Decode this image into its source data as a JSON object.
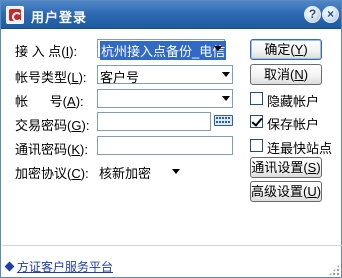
{
  "window": {
    "title": "用户登录",
    "help_glyph": "?",
    "close_glyph": "×"
  },
  "form": {
    "access_point": {
      "label": "接 入 点",
      "hotkey": "I",
      "value": "杭州接入点备份_电信"
    },
    "account_type": {
      "label": "帐号类型",
      "hotkey": "L",
      "value": "客户号"
    },
    "account": {
      "label": "帐      号",
      "hotkey": "A",
      "value": ""
    },
    "trade_password": {
      "label": "交易密码",
      "hotkey": "G",
      "value": ""
    },
    "comm_password": {
      "label": "通讯密码",
      "hotkey": "K",
      "value": ""
    },
    "encryption": {
      "label": "加密协议",
      "hotkey": "C",
      "value": "核新加密"
    }
  },
  "buttons": {
    "confirm": {
      "text": "确定",
      "hotkey": "Y"
    },
    "cancel": {
      "text": "取消",
      "hotkey": "N"
    },
    "comm_settings": {
      "text": "通讯设置",
      "hotkey": "S"
    },
    "advanced_settings": {
      "text": "高级设置",
      "hotkey": "U"
    }
  },
  "options": {
    "hide_account": {
      "label": "隐藏帐户",
      "checked": false
    },
    "save_account": {
      "label": "保存帐户",
      "checked": true
    },
    "connect_fastest": {
      "label": "连最快站点",
      "checked": false
    }
  },
  "footer": {
    "link": "方证客户服务平台"
  },
  "colors": {
    "titlebar": "#2f6bb3",
    "selection": "#3169c6",
    "link": "#1f3fa8"
  }
}
